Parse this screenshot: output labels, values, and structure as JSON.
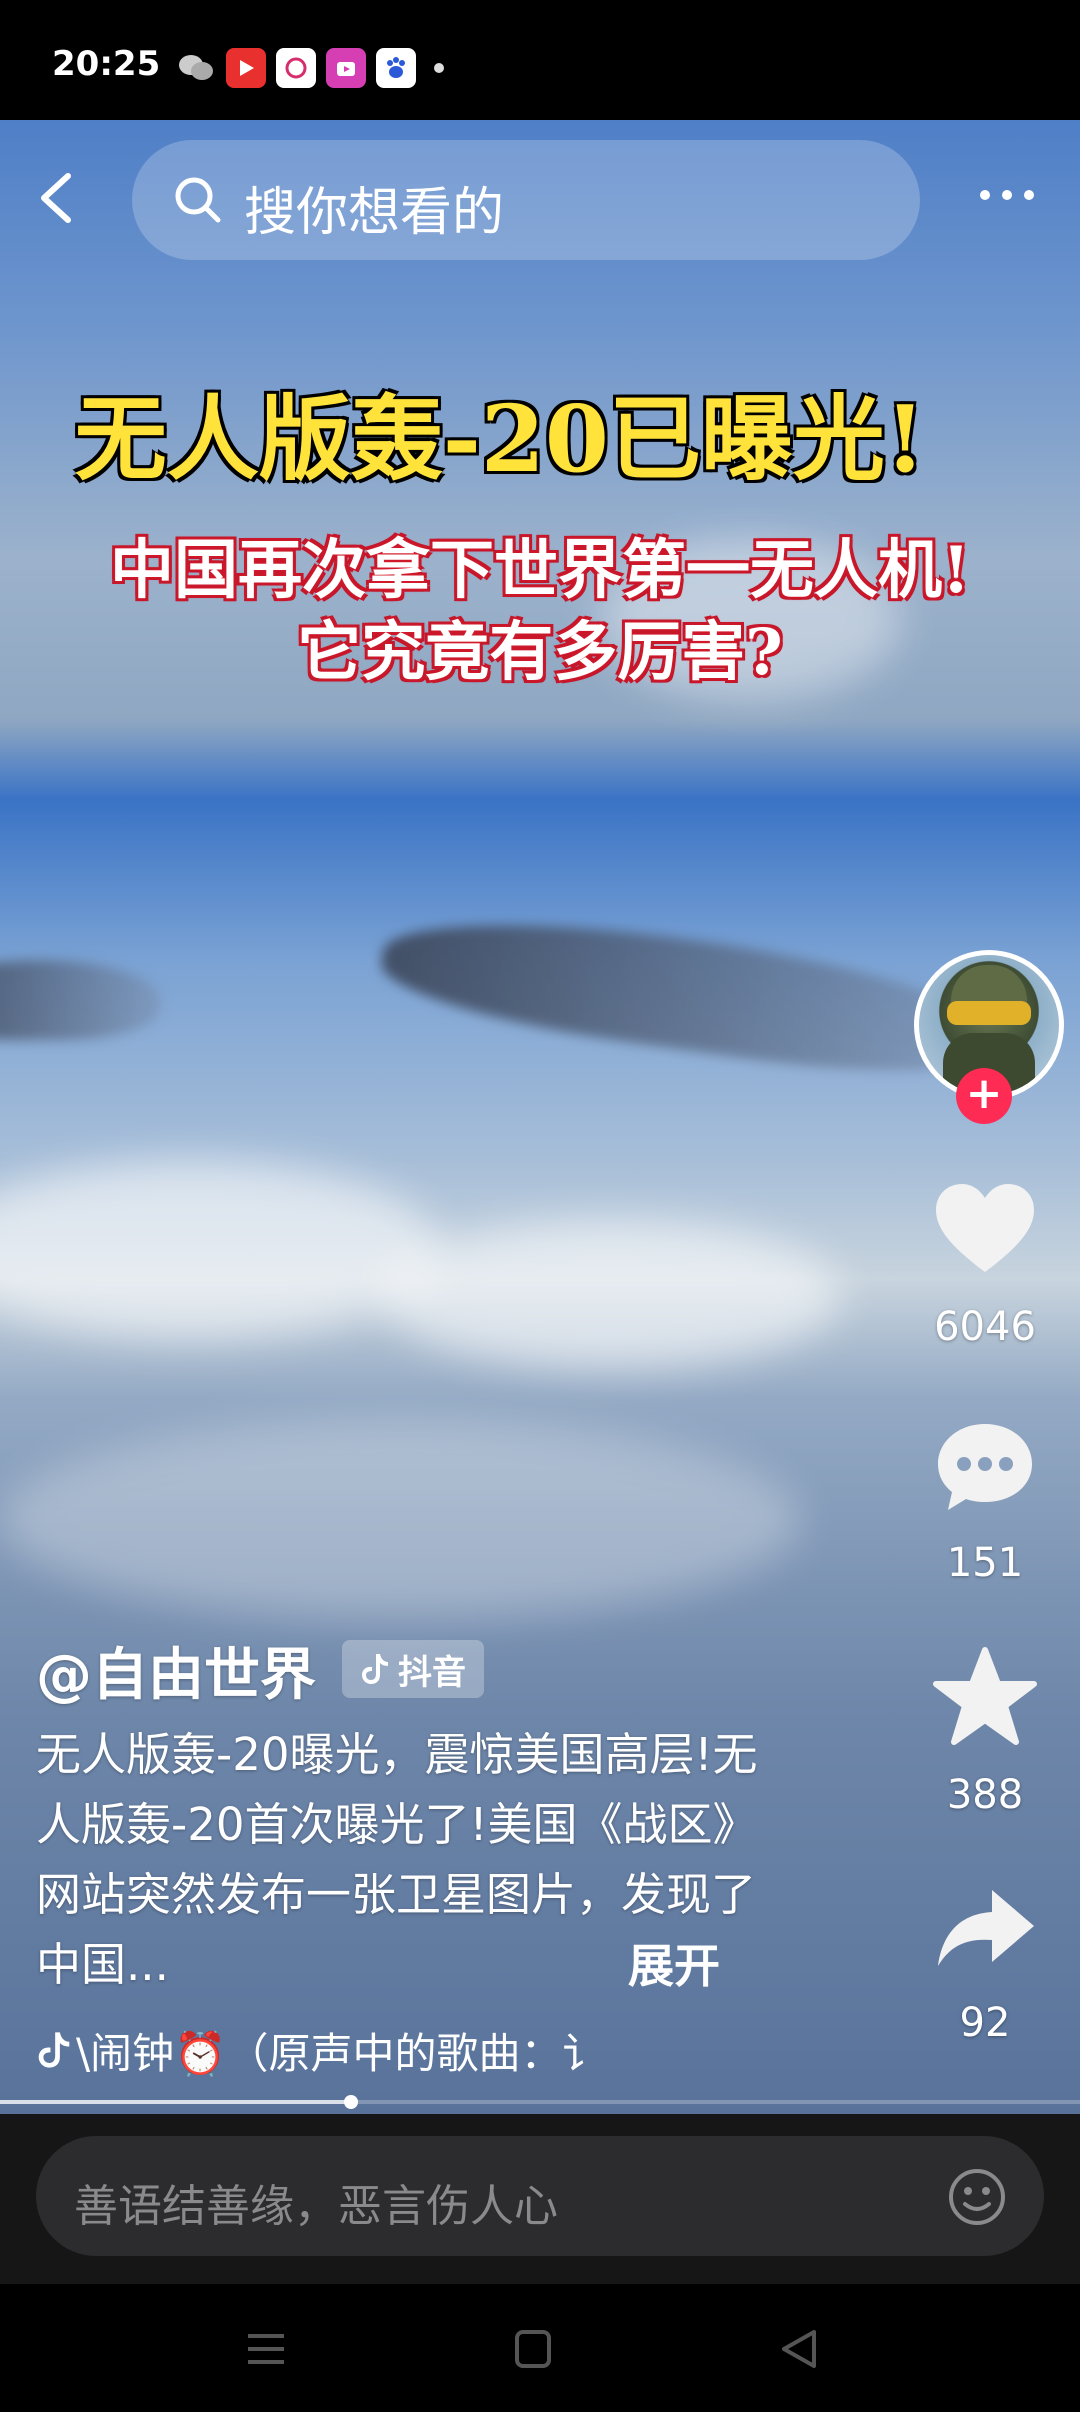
{
  "status_bar": {
    "time": "20:25"
  },
  "search": {
    "placeholder": "搜你想看的"
  },
  "video": {
    "headline_line1": "无人版轰-20已曝光!",
    "headline_line2": "中国再次拿下世界第一无人机!",
    "headline_line3": "它究竟有多厉害?"
  },
  "rail": {
    "likes": "6046",
    "comments": "151",
    "favorites": "388",
    "shares": "92"
  },
  "caption": {
    "author": "@自由世界",
    "tag": "抖音",
    "description": "无人版轰-20曝光，震惊美国高层!无人版轰-20首次曝光了!美国《战区》网站突然发布一张卫星图片，发现了中国...",
    "expand": "展开",
    "music": "\\闹钟⏰（原声中的歌曲：讠"
  },
  "progress": {
    "fraction": 0.325
  },
  "comment": {
    "placeholder": "善语结善缘，恶言伤人心"
  },
  "colors": {
    "follow": "#fe2c55",
    "headline_yellow": "#ffe23a",
    "headline_red": "#c5162a"
  }
}
